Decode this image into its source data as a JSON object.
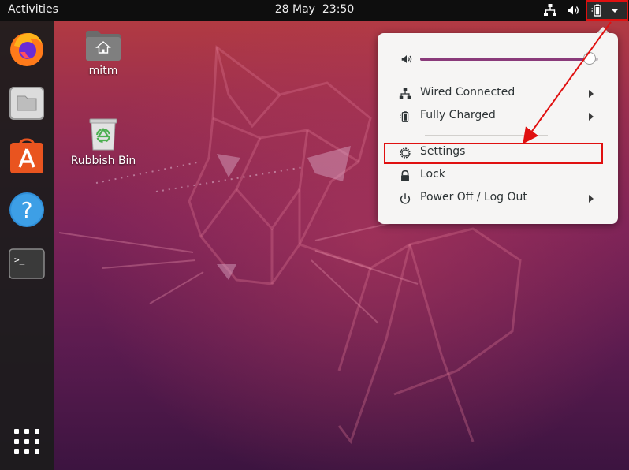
{
  "top_bar": {
    "activities": "Activities",
    "date": "28 May",
    "time": "23:50",
    "icons": [
      "network-wired-icon",
      "volume-icon",
      "battery-icon",
      "chevron-down-icon"
    ]
  },
  "dock": {
    "items": [
      "firefox-icon",
      "files-icon",
      "software-store-icon",
      "help-icon",
      "terminal-icon"
    ],
    "apps_grid": "show-applications-icon",
    "terminal_prompt": ">_"
  },
  "desktop": {
    "icons": [
      {
        "label": "mitm",
        "icon": "home-folder-icon"
      },
      {
        "label": "Rubbish Bin",
        "icon": "trash-icon"
      }
    ]
  },
  "system_menu": {
    "volume": {
      "icon": "volume-icon",
      "level": 0.95
    },
    "items": [
      {
        "label": "Wired Connected",
        "icon": "network-wired-icon",
        "submenu": true
      },
      {
        "label": "Fully Charged",
        "icon": "battery-icon",
        "submenu": true
      },
      {
        "label": "Settings",
        "icon": "gear-icon",
        "submenu": false
      },
      {
        "label": "Lock",
        "icon": "lock-icon",
        "submenu": false
      },
      {
        "label": "Power Off / Log Out",
        "icon": "power-icon",
        "submenu": true
      }
    ]
  },
  "annotation": {
    "color": "#e01010"
  },
  "colors": {
    "accent": "#8a3a7a",
    "panel": "#0e0e0e",
    "menu_bg": "#f6f5f4"
  }
}
